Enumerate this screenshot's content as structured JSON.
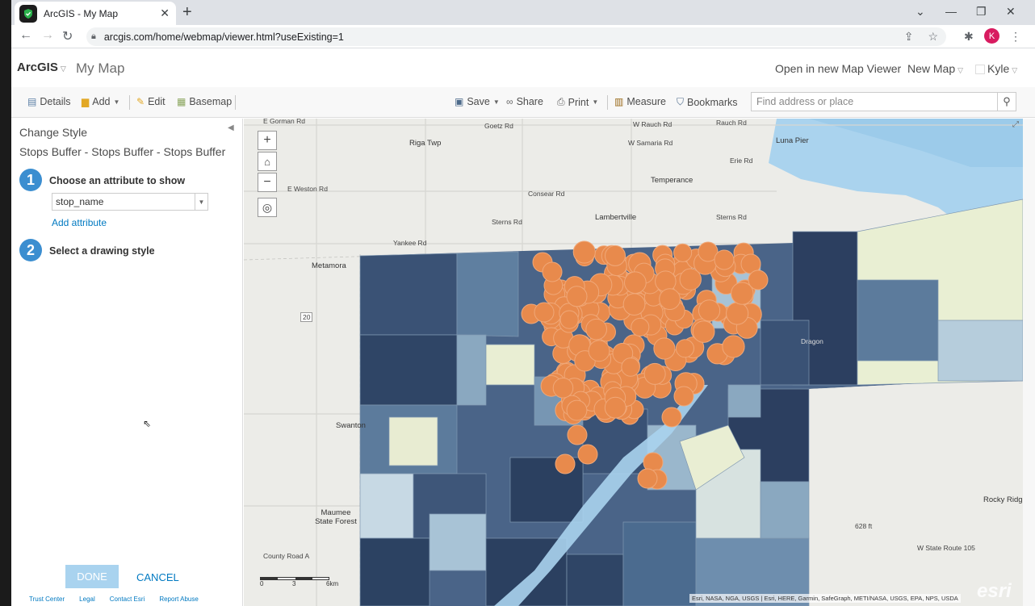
{
  "browser": {
    "tab_title": "ArcGIS - My Map",
    "url": "arcgis.com/home/webmap/viewer.html?useExisting=1",
    "profile_initial": "K"
  },
  "header": {
    "brand": "ArcGIS",
    "map_title": "My Map",
    "open_new_viewer": "Open in new Map Viewer",
    "new_map": "New Map",
    "user": "Kyle"
  },
  "toolbar": {
    "details": "Details",
    "add": "Add",
    "edit": "Edit",
    "basemap": "Basemap",
    "save": "Save",
    "share": "Share",
    "print": "Print",
    "measure": "Measure",
    "bookmarks": "Bookmarks",
    "search_placeholder": "Find address or place"
  },
  "panel": {
    "title": "Change Style",
    "subtitle": "Stops Buffer - Stops Buffer - Stops Buffer",
    "step1_num": "1",
    "step1_label": "Choose an attribute to show",
    "attribute_value": "stop_name",
    "add_attribute": "Add attribute",
    "step2_num": "2",
    "step2_label": "Select a drawing style",
    "done": "DONE",
    "cancel": "CANCEL",
    "footer_links": [
      "Trust Center",
      "Legal",
      "Contact Esri",
      "Report Abuse"
    ]
  },
  "map": {
    "labels": {
      "e_gorman": "E Gorman Rd",
      "goetz": "Goetz Rd",
      "w_rauch": "W Rauch Rd",
      "rauch": "Rauch Rd",
      "riga_twp": "Riga Twp",
      "w_samaria": "W Samaria Rd",
      "luna_pier": "Luna Pier",
      "erie": "Erie Rd",
      "temperance": "Temperance",
      "e_weston": "E Weston Rd",
      "consear": "Consear Rd",
      "lambertville": "Lambertville",
      "sterns1": "Sterns Rd",
      "sterns2": "Sterns Rd",
      "yankee": "Yankee Rd",
      "metamora": "Metamora",
      "swanton": "Swanton",
      "maumee": "Maumee State Forest",
      "county_road_a": "County Road A",
      "rocky_ridge": "Rocky Ridge",
      "w_state_route": "W State Route 105",
      "dragon": "Dragon",
      "route20": "20",
      "ft628": "628 ft"
    },
    "scale": [
      "0",
      "3",
      "6km"
    ],
    "attribution": "Esri, NASA, NGA, USGS | Esri, HERE, Garmin, SafeGraph, METI/NASA, USGS, EPA, NPS, USDA",
    "logo": "esri"
  }
}
